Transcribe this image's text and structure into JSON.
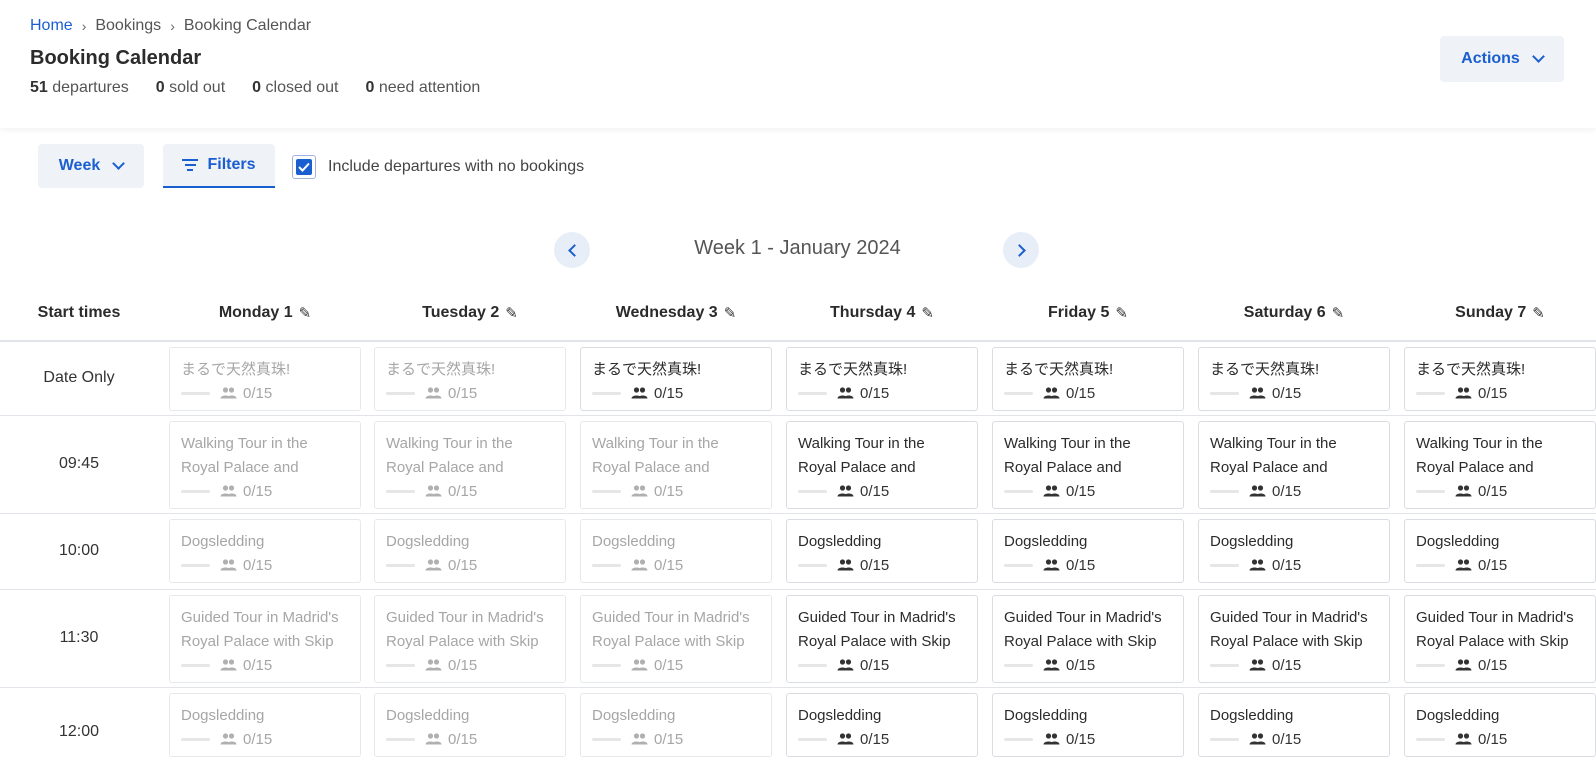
{
  "breadcrumb": {
    "home": "Home",
    "bookings": "Bookings",
    "current": "Booking Calendar"
  },
  "page": {
    "title": "Booking Calendar"
  },
  "stats": [
    {
      "value": "51",
      "label": "departures"
    },
    {
      "value": "0",
      "label": "sold out"
    },
    {
      "value": "0",
      "label": "closed out"
    },
    {
      "value": "0",
      "label": "need attention"
    }
  ],
  "actions": {
    "label": "Actions"
  },
  "toolbar": {
    "view_label": "Week",
    "filters_label": "Filters",
    "include_no_bookings_label": "Include departures with no bookings",
    "include_no_bookings_checked": true
  },
  "week_nav": {
    "label": "Week 1 - January 2024"
  },
  "grid": {
    "start_times_header": "Start times",
    "days": [
      "Monday 1",
      "Tuesday 2",
      "Wednesday 3",
      "Thursday 4",
      "Friday 5",
      "Saturday 6",
      "Sunday 7"
    ],
    "rows": [
      {
        "time": "Date Only",
        "cells": [
          {
            "title": "まるで天然真珠!",
            "capacity": "0/15",
            "muted": true
          },
          {
            "title": "まるで天然真珠!",
            "capacity": "0/15",
            "muted": true
          },
          {
            "title": "まるで天然真珠!",
            "capacity": "0/15",
            "muted": false
          },
          {
            "title": "まるで天然真珠!",
            "capacity": "0/15",
            "muted": false
          },
          {
            "title": "まるで天然真珠!",
            "capacity": "0/15",
            "muted": false
          },
          {
            "title": "まるで天然真珠!",
            "capacity": "0/15",
            "muted": false
          },
          {
            "title": "まるで天然真珠!",
            "capacity": "0/15",
            "muted": false
          }
        ]
      },
      {
        "time": "09:45",
        "cells": [
          {
            "title": "Walking Tour in the Royal Palace and Almudena…",
            "capacity": "0/15",
            "muted": true
          },
          {
            "title": "Walking Tour in the Royal Palace and Almudena…",
            "capacity": "0/15",
            "muted": true
          },
          {
            "title": "Walking Tour in the Royal Palace and Almudena…",
            "capacity": "0/15",
            "muted": true
          },
          {
            "title": "Walking Tour in the Royal Palace and Almudena…",
            "capacity": "0/15",
            "muted": false
          },
          {
            "title": "Walking Tour in the Royal Palace and Almudena…",
            "capacity": "0/15",
            "muted": false
          },
          {
            "title": "Walking Tour in the Royal Palace and Almudena…",
            "capacity": "0/15",
            "muted": false
          },
          {
            "title": "Walking Tour in the Royal Palace and Almudena…",
            "capacity": "0/15",
            "muted": false
          }
        ]
      },
      {
        "time": "10:00",
        "cells": [
          {
            "title": "Dogsledding",
            "capacity": "0/15",
            "muted": true
          },
          {
            "title": "Dogsledding",
            "capacity": "0/15",
            "muted": true
          },
          {
            "title": "Dogsledding",
            "capacity": "0/15",
            "muted": true
          },
          {
            "title": "Dogsledding",
            "capacity": "0/15",
            "muted": false
          },
          {
            "title": "Dogsledding",
            "capacity": "0/15",
            "muted": false
          },
          {
            "title": "Dogsledding",
            "capacity": "0/15",
            "muted": false
          },
          {
            "title": "Dogsledding",
            "capacity": "0/15",
            "muted": false
          }
        ]
      },
      {
        "time": "11:30",
        "cells": [
          {
            "title": "Guided Tour in Madrid's Royal Palace with Skip t…",
            "capacity": "0/15",
            "muted": true
          },
          {
            "title": "Guided Tour in Madrid's Royal Palace with Skip t…",
            "capacity": "0/15",
            "muted": true
          },
          {
            "title": "Guided Tour in Madrid's Royal Palace with Skip t…",
            "capacity": "0/15",
            "muted": true
          },
          {
            "title": "Guided Tour in Madrid's Royal Palace with Skip t…",
            "capacity": "0/15",
            "muted": false
          },
          {
            "title": "Guided Tour in Madrid's Royal Palace with Skip t…",
            "capacity": "0/15",
            "muted": false
          },
          {
            "title": "Guided Tour in Madrid's Royal Palace with Skip t…",
            "capacity": "0/15",
            "muted": false
          },
          {
            "title": "Guided Tour in Madrid's Royal Palace with Skip t…",
            "capacity": "0/15",
            "muted": false
          }
        ]
      },
      {
        "time": "12:00",
        "cells": [
          {
            "title": "Dogsledding",
            "capacity": "0/15",
            "muted": true
          },
          {
            "title": "Dogsledding",
            "capacity": "0/15",
            "muted": true
          },
          {
            "title": "Dogsledding",
            "capacity": "0/15",
            "muted": true
          },
          {
            "title": "Dogsledding",
            "capacity": "0/15",
            "muted": false
          },
          {
            "title": "Dogsledding",
            "capacity": "0/15",
            "muted": false
          },
          {
            "title": "Dogsledding",
            "capacity": "0/15",
            "muted": false
          },
          {
            "title": "Dogsledding",
            "capacity": "0/15",
            "muted": false
          }
        ]
      }
    ]
  },
  "icons": {
    "pencil": "pencil-icon",
    "people": "people-icon",
    "filter": "filter-icon",
    "chevron": "chevron-down-icon"
  },
  "colors": {
    "accent": "#1a5fd0",
    "button_bg": "#eff2f6",
    "muted_text": "#a6a6a6"
  }
}
